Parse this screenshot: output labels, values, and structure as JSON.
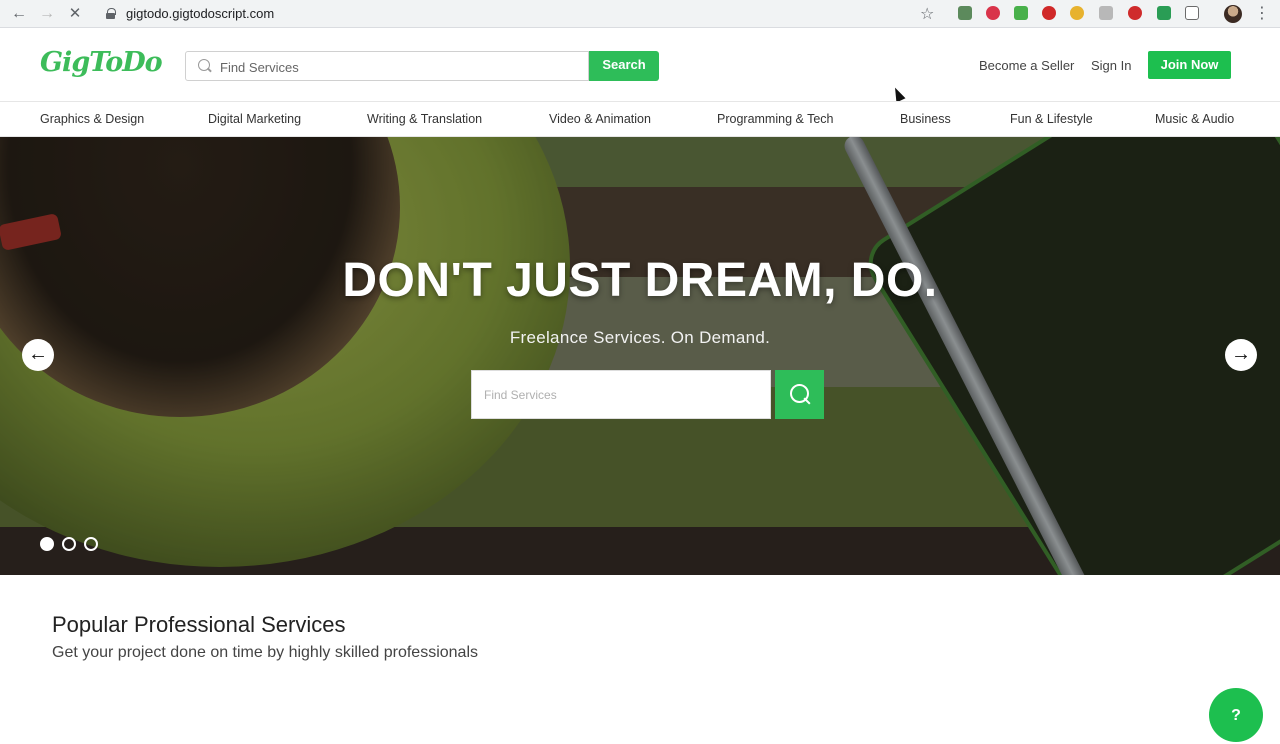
{
  "browser": {
    "url": "gigtodo.gigtodoscript.com",
    "back_icon": "arrow-left-icon",
    "forward_icon": "arrow-right-icon",
    "reload_icon": "close-icon",
    "extensions": [
      "extension-pen-icon",
      "extension-red-icon",
      "extension-green-icon",
      "adblock-abp-icon",
      "extension-bulb-icon",
      "extension-gray-icon",
      "extension-red-circle-icon",
      "extension-green-square-icon",
      "extension-window-icon"
    ]
  },
  "header": {
    "logo": "GigToDo",
    "search_placeholder": "Find Services",
    "search_button": "Search",
    "become_seller": "Become a Seller",
    "sign_in": "Sign In",
    "join_now": "Join Now"
  },
  "categories": [
    "Graphics & Design",
    "Digital Marketing",
    "Writing & Translation",
    "Video & Animation",
    "Programming & Tech",
    "Business",
    "Fun & Lifestyle",
    "Music & Audio"
  ],
  "hero": {
    "title": "DON'T JUST DREAM, DO.",
    "subtitle": "Freelance Services. On Demand.",
    "search_placeholder": "Find Services",
    "slides": 3,
    "active_slide": 1
  },
  "popular": {
    "title": "Popular Professional Services",
    "subtitle": "Get your project done on time by highly skilled professionals"
  },
  "help_button": "?",
  "colors": {
    "brand_green": "#1dbf4f",
    "search_green": "#2ebd59"
  }
}
